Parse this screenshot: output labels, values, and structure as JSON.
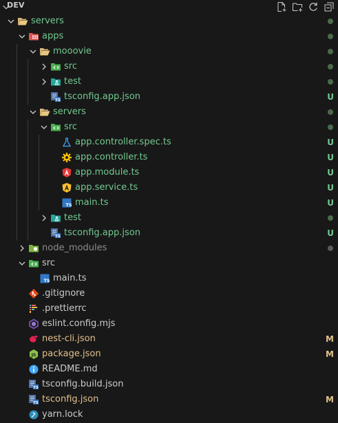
{
  "explorer": {
    "title": "DEV",
    "actions": [
      "new-file",
      "new-folder",
      "refresh",
      "collapse-all"
    ]
  },
  "colors": {
    "green": "#73c991",
    "yellow": "#e2c08d",
    "grey": "#8c8c8c",
    "default": "#cccccc",
    "dot_green": "#4b6b4b",
    "dot_grey": "#5a5a5a"
  },
  "tree": [
    {
      "label": "servers",
      "icon": "folder-open-icon",
      "color": "green",
      "status": "dot"
    },
    {
      "label": "apps",
      "icon": "folder-apps-icon",
      "color": "green",
      "status": "dot"
    },
    {
      "label": "mooovie",
      "icon": "folder-open-icon",
      "color": "green",
      "status": "dot"
    },
    {
      "label": "src",
      "icon": "folder-src-icon",
      "color": "green",
      "status": "dot"
    },
    {
      "label": "test",
      "icon": "folder-test-icon",
      "color": "green",
      "status": "dot"
    },
    {
      "label": "tsconfig.app.json",
      "icon": "tsconfig-icon",
      "color": "green",
      "status": "U"
    },
    {
      "label": "servers",
      "icon": "folder-open-icon",
      "color": "green",
      "status": "dot"
    },
    {
      "label": "src",
      "icon": "folder-src-icon",
      "color": "green",
      "status": "dot"
    },
    {
      "label": "app.controller.spec.ts",
      "icon": "test-flask-icon",
      "color": "green",
      "status": "U"
    },
    {
      "label": "app.controller.ts",
      "icon": "gear-icon",
      "color": "green",
      "status": "U"
    },
    {
      "label": "app.module.ts",
      "icon": "angular-module-icon",
      "color": "green",
      "status": "U"
    },
    {
      "label": "app.service.ts",
      "icon": "angular-service-icon",
      "color": "green",
      "status": "U"
    },
    {
      "label": "main.ts",
      "icon": "typescript-icon",
      "color": "green",
      "status": "U"
    },
    {
      "label": "test",
      "icon": "folder-test-icon",
      "color": "green",
      "status": "dot"
    },
    {
      "label": "tsconfig.app.json",
      "icon": "tsconfig-icon",
      "color": "green",
      "status": "U"
    },
    {
      "label": "node_modules",
      "icon": "folder-node-icon",
      "color": "grey",
      "status": "dot"
    },
    {
      "label": "src",
      "icon": "folder-src-icon",
      "color": "default",
      "status": ""
    },
    {
      "label": "main.ts",
      "icon": "typescript-icon",
      "color": "default",
      "status": ""
    },
    {
      "label": ".gitignore",
      "icon": "git-icon",
      "color": "default",
      "status": ""
    },
    {
      "label": ".prettierrc",
      "icon": "prettier-icon",
      "color": "default",
      "status": ""
    },
    {
      "label": "eslint.config.mjs",
      "icon": "eslint-icon",
      "color": "default",
      "status": ""
    },
    {
      "label": "nest-cli.json",
      "icon": "nest-icon",
      "color": "yellow",
      "status": "M"
    },
    {
      "label": "package.json",
      "icon": "nodejs-icon",
      "color": "yellow",
      "status": "M"
    },
    {
      "label": "README.md",
      "icon": "info-icon",
      "color": "default",
      "status": ""
    },
    {
      "label": "tsconfig.build.json",
      "icon": "tsconfig-icon",
      "color": "default",
      "status": ""
    },
    {
      "label": "tsconfig.json",
      "icon": "tsconfig-icon",
      "color": "yellow",
      "status": "M"
    },
    {
      "label": "yarn.lock",
      "icon": "yarn-icon",
      "color": "default",
      "status": ""
    }
  ]
}
